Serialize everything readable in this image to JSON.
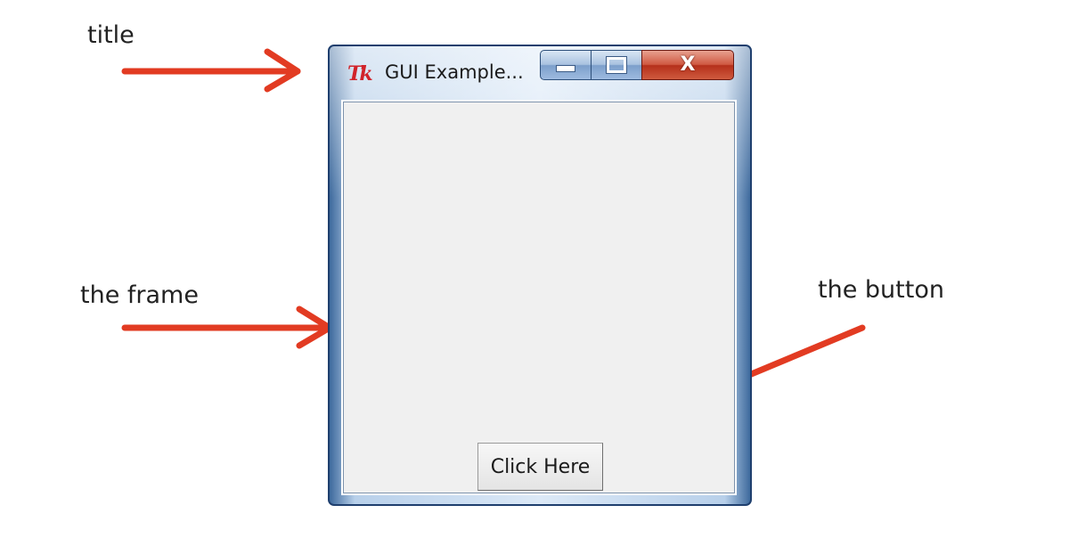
{
  "annotations": {
    "title": "title",
    "frame": "the frame",
    "button": "the button"
  },
  "window": {
    "icon_text": "Tk",
    "title": "GUI Example...",
    "close_glyph": "X"
  },
  "client": {
    "button_label": "Click Here"
  },
  "colors": {
    "arrow": "#e23b22",
    "client_bg": "#f0f0f0",
    "close_button": "#c4402a",
    "frame_border": "#1f3f6e"
  }
}
